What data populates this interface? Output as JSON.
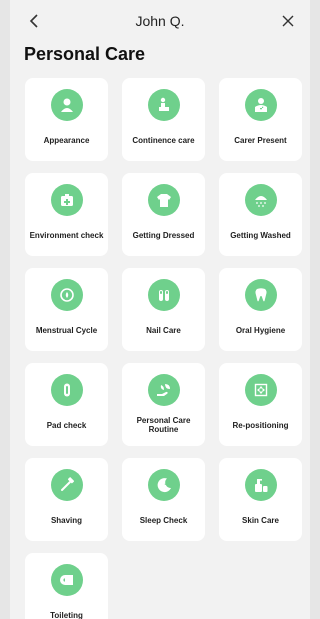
{
  "header": {
    "title": "John Q.",
    "back_icon": "chevron-left-icon",
    "close_icon": "close-icon"
  },
  "page": {
    "title": "Personal Care"
  },
  "colors": {
    "accent": "#6fd08c",
    "background": "#f2f2f2",
    "tile": "#ffffff"
  },
  "tiles": [
    {
      "label": "Appearance",
      "icon": "person-icon"
    },
    {
      "label": "Continence care",
      "icon": "toilet-person-icon"
    },
    {
      "label": "Carer Present",
      "icon": "carer-icon"
    },
    {
      "label": "Environment check",
      "icon": "first-aid-icon"
    },
    {
      "label": "Getting Dressed",
      "icon": "shirt-icon"
    },
    {
      "label": "Getting Washed",
      "icon": "shower-icon"
    },
    {
      "label": "Menstrual Cycle",
      "icon": "cycle-icon"
    },
    {
      "label": "Nail Care",
      "icon": "nail-icon"
    },
    {
      "label": "Oral Hygiene",
      "icon": "tooth-icon"
    },
    {
      "label": "Pad check",
      "icon": "pad-icon"
    },
    {
      "label": "Personal Care Routine",
      "icon": "care-routine-icon"
    },
    {
      "label": "Re-positioning",
      "icon": "reposition-icon"
    },
    {
      "label": "Shaving",
      "icon": "razor-icon"
    },
    {
      "label": "Sleep Check",
      "icon": "moon-icon"
    },
    {
      "label": "Skin Care",
      "icon": "lotion-icon"
    },
    {
      "label": "Toileting",
      "icon": "toilet-paper-icon"
    }
  ]
}
